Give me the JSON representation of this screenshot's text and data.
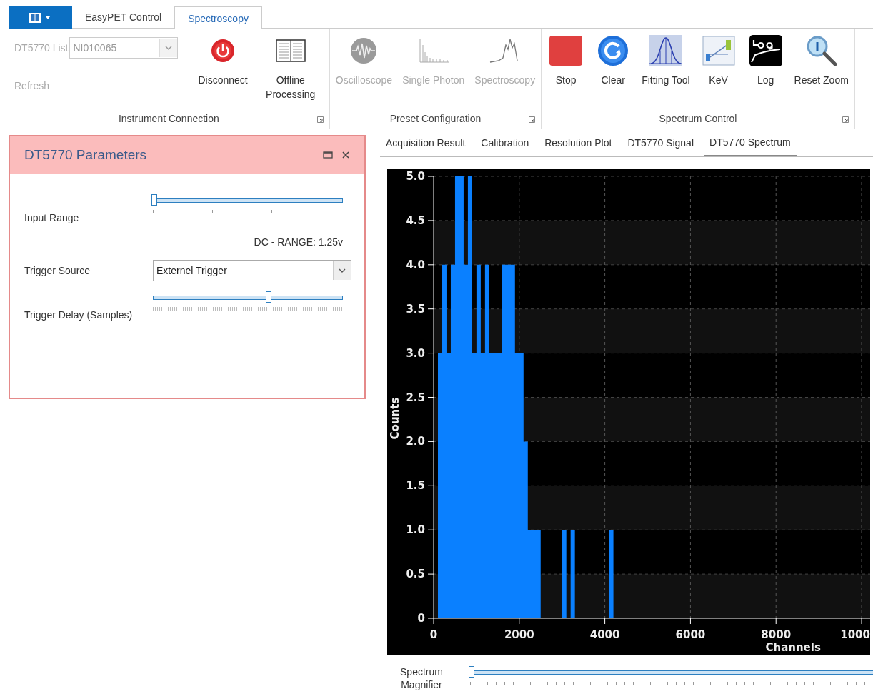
{
  "ribbon_tabs": [
    {
      "label": "EasyPET Control",
      "selected": false
    },
    {
      "label": "Spectroscopy",
      "selected": true
    }
  ],
  "ribbon_groups": [
    {
      "label": "Instrument Connection",
      "device_list": {
        "label": "DT5770 List",
        "value": "NI010065",
        "disabled": true
      },
      "refresh": {
        "label": "Refresh",
        "disabled": true
      },
      "buttons": [
        {
          "label": "Disconnect",
          "kind": "power",
          "disabled": false
        },
        {
          "label": "Offline Processing",
          "kind": "book",
          "disabled": false
        }
      ]
    },
    {
      "label": "Preset Configuration",
      "buttons": [
        {
          "label": "Oscilloscope",
          "kind": "wave",
          "disabled": true
        },
        {
          "label": "Single Photon",
          "kind": "decay",
          "disabled": true
        },
        {
          "label": "Spectroscopy",
          "kind": "spectrum",
          "disabled": true
        }
      ]
    },
    {
      "label": "Spectrum Control",
      "buttons": [
        {
          "label": "Stop",
          "kind": "stop",
          "disabled": false
        },
        {
          "label": "Clear",
          "kind": "clear",
          "disabled": false
        },
        {
          "label": "Fitting Tool",
          "kind": "fit",
          "disabled": false
        },
        {
          "label": "KeV",
          "kind": "kev",
          "disabled": false
        },
        {
          "label": "Log",
          "kind": "log",
          "disabled": false
        },
        {
          "label": "Reset Zoom",
          "kind": "zoom",
          "disabled": false
        }
      ]
    }
  ],
  "panel": {
    "title": "DT5770 Parameters",
    "rows": [
      {
        "kind": "slider",
        "label": "Input Range",
        "level": 0
      },
      {
        "kind": "readout",
        "text": "DC - RANGE: 1.25v"
      },
      {
        "kind": "select",
        "label": "Trigger Source",
        "value": "Externel Trigger"
      },
      {
        "kind": "fineslider",
        "label": "Trigger Delay (Samples)",
        "level": 0.6
      }
    ]
  },
  "result_tabs": [
    {
      "label": "Acquisition Result",
      "selected": false
    },
    {
      "label": "Calibration",
      "selected": false
    },
    {
      "label": "Resolution Plot",
      "selected": false
    },
    {
      "label": "DT5770 Signal",
      "selected": false
    },
    {
      "label": "DT5770 Spectrum",
      "selected": true
    }
  ],
  "spectrum": {
    "edge_tick_label": "1000",
    "chart_data": {
      "type": "area",
      "xlabel": "Channels",
      "ylabel": "Counts",
      "grid": true,
      "x": [
        0,
        100,
        200,
        300,
        400,
        500,
        600,
        700,
        800,
        900,
        1000,
        1100,
        1200,
        1300,
        1400,
        1500,
        1600,
        1700,
        1800,
        1900,
        2000,
        2100,
        2200,
        2300,
        2400,
        2500,
        2600,
        2700,
        2800,
        2900,
        3000,
        3100,
        3200,
        3300,
        3400,
        3500,
        3600,
        3700,
        3800,
        3900,
        4000,
        4100,
        4200
      ],
      "values": [
        0,
        3,
        4,
        3,
        4,
        5,
        5,
        4,
        5,
        3,
        4,
        3,
        4,
        3,
        3,
        3,
        4,
        4,
        4,
        3,
        3,
        2,
        1,
        1,
        1,
        0,
        0,
        0,
        0,
        0,
        1,
        0,
        1,
        0,
        0,
        0,
        0,
        0,
        0,
        0,
        0,
        1,
        0
      ],
      "xlim": [
        0,
        10200
      ],
      "ylim": [
        0,
        5
      ],
      "xticks": [
        0,
        2000,
        4000,
        6000,
        8000
      ],
      "yticks": [
        {
          "value": 0,
          "label": "0"
        },
        {
          "value": 0.5,
          "label": "0.5"
        },
        {
          "value": 1,
          "label": "1.0"
        },
        {
          "value": 1.5,
          "label": "1.5"
        },
        {
          "value": 2,
          "label": "2.0"
        },
        {
          "value": 2.5,
          "label": "2.5"
        },
        {
          "value": 3,
          "label": "3.0"
        },
        {
          "value": 3.5,
          "label": "3.5"
        },
        {
          "value": 4,
          "label": "4.0"
        },
        {
          "value": 4.5,
          "label": "4.5"
        },
        {
          "value": 5,
          "label": "5.0"
        }
      ]
    }
  },
  "magnifier": {
    "label": "Spectrum Magnifier",
    "level": 0
  }
}
